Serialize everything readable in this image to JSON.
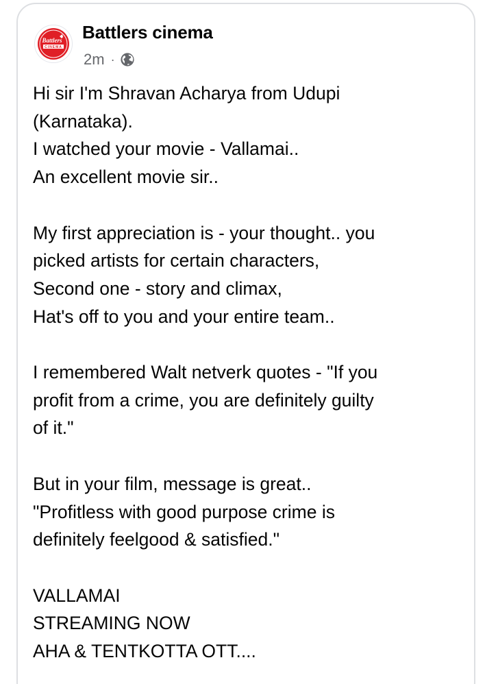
{
  "post": {
    "page_name": "Battlers cinema",
    "timestamp": "2m",
    "separator": "·",
    "audience_icon": "globe-icon",
    "avatar": {
      "logo_text_top": "Battlers",
      "logo_text_bottom": "CINEMA",
      "brand_color": "#e01f26"
    },
    "lines": [
      "Hi sir I'm Shravan Acharya from Udupi",
      "(Karnataka).",
      "I watched your movie - Vallamai..",
      "An excellent movie sir..",
      "",
      "My first appreciation is - your thought.. you",
      "picked artists for certain characters,",
      "Second one - story and climax,",
      "Hat's off to you and your entire team..",
      "",
      "I remembered Walt netverk quotes - \"If you",
      "profit from a crime, you are definitely guilty",
      "of it.\"",
      "",
      "But in your film, message is great..",
      "\"Profitless with good purpose crime is",
      "definitely feelgood & satisfied.\"",
      "",
      "VALLAMAI",
      "STREAMING NOW",
      "AHA & TENTKOTTA OTT...."
    ]
  },
  "colors": {
    "text_primary": "#050505",
    "text_secondary": "#65676b",
    "card_border": "#dddfe2"
  }
}
